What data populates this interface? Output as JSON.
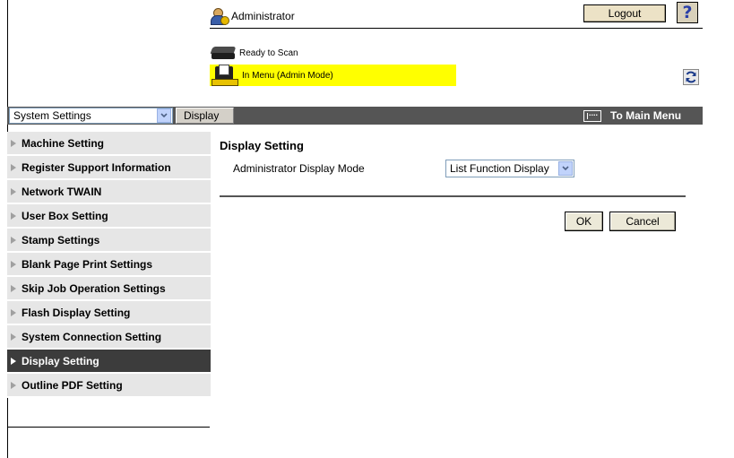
{
  "header": {
    "user_label": "Administrator",
    "logout_label": "Logout",
    "help_label": "?"
  },
  "status": {
    "scan": "Ready to Scan",
    "menu": "In Menu (Admin Mode)"
  },
  "toolbar": {
    "category_value": "System Settings",
    "tab_label": "Display",
    "main_menu_label": "To Main Menu"
  },
  "sidebar": {
    "items": [
      {
        "label": "Machine Setting",
        "active": false
      },
      {
        "label": "Register Support Information",
        "active": false
      },
      {
        "label": "Network TWAIN",
        "active": false
      },
      {
        "label": "User Box Setting",
        "active": false
      },
      {
        "label": "Stamp Settings",
        "active": false
      },
      {
        "label": "Blank Page Print Settings",
        "active": false
      },
      {
        "label": "Skip Job Operation Settings",
        "active": false
      },
      {
        "label": "Flash Display Setting",
        "active": false
      },
      {
        "label": "System Connection Setting",
        "active": false
      },
      {
        "label": "Display Setting",
        "active": true
      },
      {
        "label": "Outline PDF Setting",
        "active": false
      }
    ]
  },
  "main": {
    "title": "Display Setting",
    "setting_label": "Administrator Display Mode",
    "setting_value": "List Function Display",
    "ok_label": "OK",
    "cancel_label": "Cancel"
  },
  "colors": {
    "toolbar_bg": "#555555",
    "status_highlight": "#ffff00",
    "active_item_bg": "#3c3c3c",
    "side_item_bg": "#e6e6e6"
  }
}
